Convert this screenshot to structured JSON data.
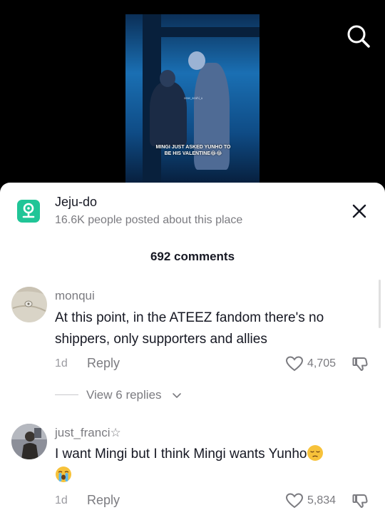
{
  "video": {
    "caption": "MINGI JUST ASKED YUNHO TO BE HIS VALENTINE",
    "caption_emoji": "😂😂",
    "watermark": "seas_asahi_u"
  },
  "icons": {
    "search": "search-icon",
    "close": "close-icon",
    "place": "location-pin-icon"
  },
  "place": {
    "name": "Jeju-do",
    "subtitle": "16.6K people posted about this place",
    "accent": "#20c597"
  },
  "comments_header": {
    "count_label": "692 comments"
  },
  "comments": [
    {
      "username": "monqui",
      "text": "At this point, in the ATEEZ fandom there's no shippers, only supporters and allies",
      "time": "1d",
      "reply_label": "Reply",
      "likes": "4,705",
      "view_replies": "View 6 replies"
    },
    {
      "username": "just_franci☆",
      "text": "I want Mingi but I think Mingi wants Yunho",
      "text_emoji": "😔😭",
      "time": "1d",
      "reply_label": "Reply",
      "likes": "5,834"
    }
  ]
}
